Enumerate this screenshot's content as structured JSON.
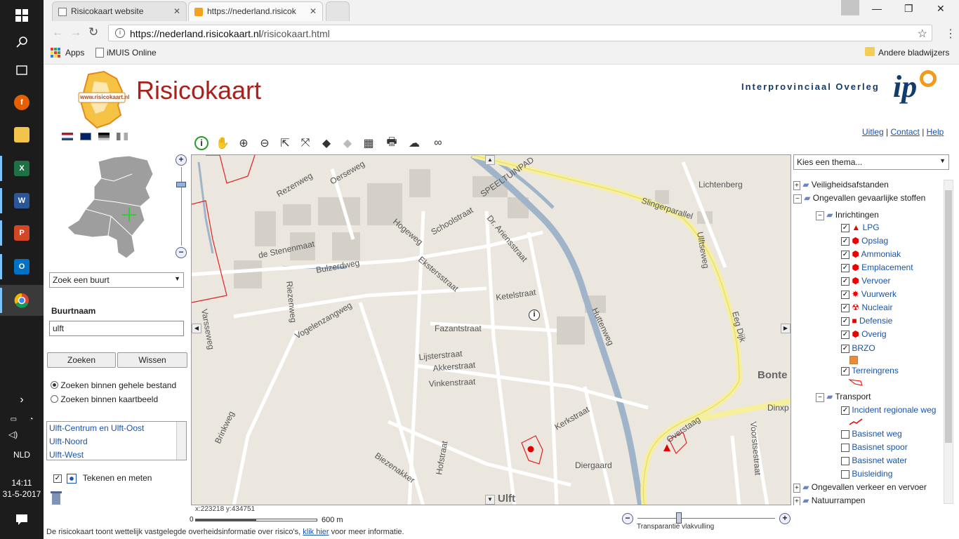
{
  "taskbar": {
    "lang": "NLD",
    "time": "14:11",
    "date": "31-5-2017"
  },
  "browser": {
    "tabs": [
      {
        "title": "Risicokaart website"
      },
      {
        "title": "https://nederland.risicok"
      }
    ],
    "url_host": "https://nederland.risicokaart.nl",
    "url_path": "/risicokaart.html",
    "bookmarks": {
      "apps": "Apps",
      "imuis": "iMUIS Online",
      "other": "Andere bladwijzers"
    }
  },
  "header": {
    "brand": "Risicokaart",
    "logo_text": "www.risicokaart.nl",
    "ipo_text": "Interprovinciaal Overleg",
    "ipo_logo": "ip",
    "links": {
      "uitleg": "Uitleg",
      "contact": "Contact",
      "help": "Help"
    }
  },
  "left": {
    "search_select": "Zoek een buurt",
    "label": "Buurtnaam",
    "input_value": "ulft",
    "search_btn": "Zoeken",
    "clear_btn": "Wissen",
    "radio1": "Zoeken binnen gehele bestand",
    "radio2": "Zoeken binnen kaartbeeld",
    "results": [
      "Ulft-Centrum en Ulft-Oost",
      "Ulft-Noord",
      "Ulft-West"
    ],
    "draw_label": "Tekenen en meten"
  },
  "map": {
    "coords": "x:223218 y:434751",
    "scale_start": "0",
    "scale_end": "600 m",
    "transparency": "Transparantie vlakvulling",
    "footer": "De risicokaart toont wettelijk vastgelegde overheidsinformatie over risico's,",
    "footer_link": "klik hier",
    "footer_end": "voor meer informatie.",
    "labels": {
      "l1": "Lichtenberg",
      "l2": "Slingerparallel",
      "l3": "Ulftseweg",
      "l4": "SPEELTUINPAD",
      "l5": "Rezenweg",
      "l6": "Oerseweg",
      "l7": "de Stenenmaat",
      "l8": "Bulzerdweg",
      "l9": "Riezenweg",
      "l10": "Vogelenzangweg",
      "l11": "Fazantstraat",
      "l12": "Lijsterstraat",
      "l13": "Akkerstraat",
      "l14": "Vinkenstraat",
      "l15": "Ketelstraat",
      "l16": "Huttenweg",
      "l17": "Diergaard",
      "l18": "Dinxp",
      "l19": "Bonte",
      "l20": "Ulft",
      "l21": "Kerkstraat",
      "l22": "Schoolstraat",
      "l23": "Hogeweg",
      "l24": "Dr. Ariensstraat",
      "l25": "Ekstersstraat",
      "l26": "Eeg Dijk",
      "l27": "Voorstsestraat",
      "l28": "Overstaag",
      "l29": "Biezenakker",
      "l30": "Hofstraat",
      "l31": "Brinkweg",
      "l32": "Varsseweg"
    }
  },
  "themes": {
    "select": "Kies een thema...",
    "items": {
      "veiligheid": "Veiligheidsafstanden",
      "ongevallen": "Ongevallen gevaarlijke stoffen",
      "inrichtingen": "Inrichtingen",
      "lpg": "LPG",
      "opslag": "Opslag",
      "ammoniak": "Ammoniak",
      "emplacement": "Emplacement",
      "vervoer": "Vervoer",
      "vuurwerk": "Vuurwerk",
      "nucleair": "Nucleair",
      "defensie": "Defensie",
      "overig": "Overig",
      "brzo": "BRZO",
      "terreingrens": "Terreingrens",
      "transport": "Transport",
      "incident": "Incident regionale weg",
      "basisweg": "Basisnet weg",
      "basisspoor": "Basisnet spoor",
      "basiswater": "Basisnet water",
      "buisleiding": "Buisleiding",
      "verkeer": "Ongevallen verkeer en vervoer",
      "natuur": "Natuurrampen"
    }
  },
  "colors": {
    "accent": "#1a54a8",
    "brand_red": "#a8221d",
    "danger": "#e00000"
  }
}
